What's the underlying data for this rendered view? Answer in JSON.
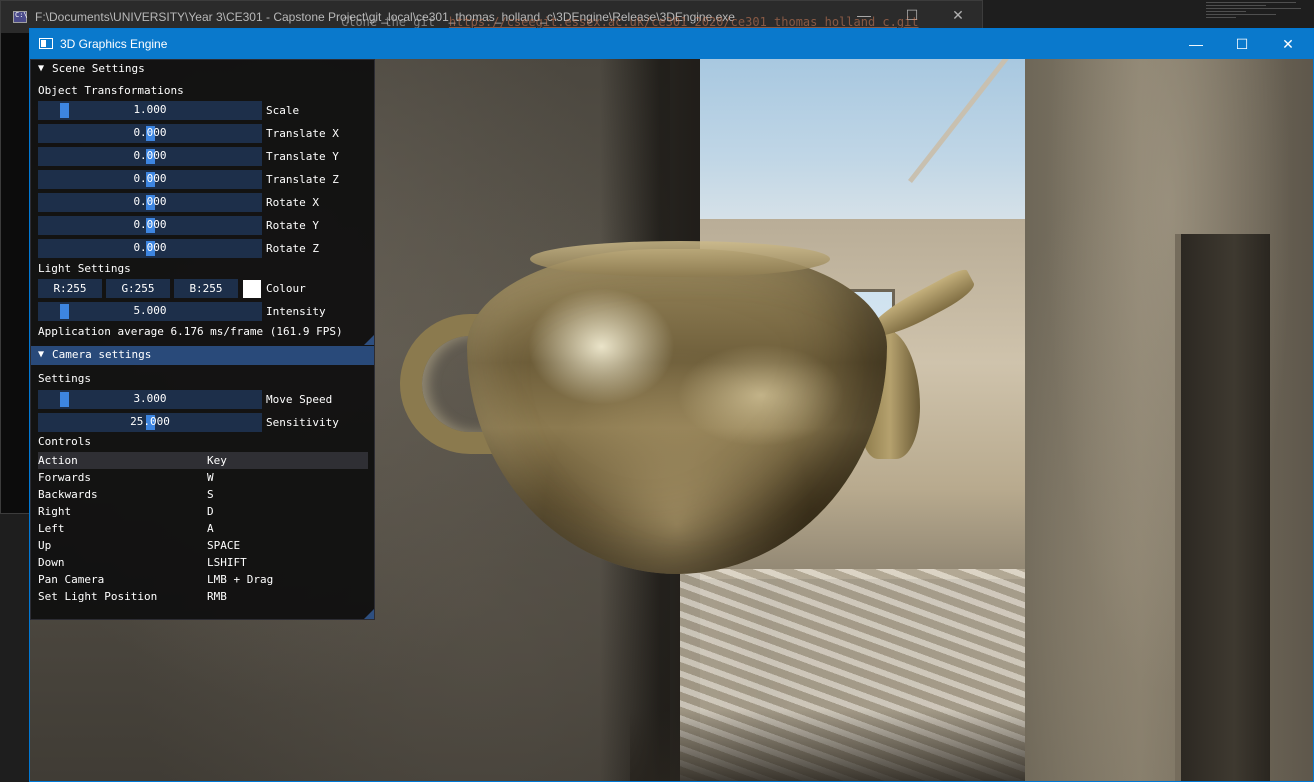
{
  "console": {
    "title": "F:\\Documents\\UNIVERSITY\\Year 3\\CE301 - Capstone Project\\git_local\\ce301_thomas_holland_c\\3DEngine\\Release\\3DEngine.exe",
    "minimize": "—",
    "maximize": "☐",
    "close": "✕",
    "text_fragment": "Clone the git",
    "url_fragment": "https://cseegit.essex.ac.uk/ce301_2020/ce301_thomas_holland_c.git"
  },
  "app": {
    "title": "3D Graphics Engine",
    "minimize": "—",
    "maximize": "☐",
    "close": "✕"
  },
  "scene_settings": {
    "header": "Scene Settings",
    "arrow": "▼",
    "object_transformations_label": "Object Transformations",
    "sliders": [
      {
        "value": "1.000",
        "label": "Scale",
        "fraction": 0.1
      },
      {
        "value": "0.000",
        "label": "Translate X",
        "fraction": 0.5
      },
      {
        "value": "0.000",
        "label": "Translate Y",
        "fraction": 0.5
      },
      {
        "value": "0.000",
        "label": "Translate Z",
        "fraction": 0.5
      },
      {
        "value": "0.000",
        "label": "Rotate X",
        "fraction": 0.5
      },
      {
        "value": "0.000",
        "label": "Rotate Y",
        "fraction": 0.5
      },
      {
        "value": "0.000",
        "label": "Rotate Z",
        "fraction": 0.5
      }
    ],
    "light_settings_label": "Light Settings",
    "colour": {
      "r": "R:255",
      "g": "G:255",
      "b": "B:255",
      "label": "Colour",
      "swatch": "#ffffff"
    },
    "intensity": {
      "value": "5.000",
      "label": "Intensity",
      "fraction": 0.1
    },
    "stats": "Application average 6.176 ms/frame (161.9 FPS)"
  },
  "camera_settings": {
    "header": "Camera settings",
    "arrow": "▼",
    "settings_label": "Settings",
    "move_speed": {
      "value": "3.000",
      "label": "Move Speed",
      "fraction": 0.1
    },
    "sensitivity": {
      "value": "25.000",
      "label": "Sensitivity",
      "fraction": 0.5
    },
    "controls_label": "Controls",
    "controls_headers": {
      "action": "Action",
      "key": "Key"
    },
    "controls": [
      {
        "action": "Forwards",
        "key": "W"
      },
      {
        "action": "Backwards",
        "key": "S"
      },
      {
        "action": "Right",
        "key": "D"
      },
      {
        "action": "Left",
        "key": "A"
      },
      {
        "action": "Up",
        "key": "SPACE"
      },
      {
        "action": "Down",
        "key": "LSHIFT"
      },
      {
        "action": "Pan Camera",
        "key": "LMB + Drag"
      },
      {
        "action": "Set Light Position",
        "key": "RMB"
      }
    ]
  },
  "colors": {
    "accent": "#0a79cc",
    "imgui_frame": "#1d2f4a",
    "imgui_grab": "#3d85e0",
    "imgui_header_active": "#294a7a"
  },
  "icons": {
    "console_icon": "console-app-icon",
    "app_icon": "window-app-icon"
  }
}
